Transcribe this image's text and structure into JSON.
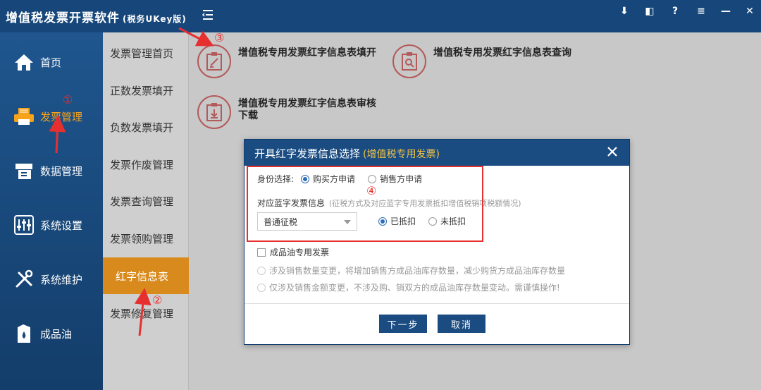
{
  "app": {
    "title": "增值税发票开票软件",
    "subtitle": "(税务UKey版)"
  },
  "window_controls": [
    "⬇",
    "◧",
    "?",
    "≡",
    "—",
    "✕"
  ],
  "sidebar": {
    "items": [
      {
        "label": "首页",
        "icon": "home-icon"
      },
      {
        "label": "发票管理",
        "icon": "printer-icon",
        "active": true
      },
      {
        "label": "数据管理",
        "icon": "data-icon"
      },
      {
        "label": "系统设置",
        "icon": "sliders-icon"
      },
      {
        "label": "系统维护",
        "icon": "tools-icon"
      },
      {
        "label": "成品油",
        "icon": "oil-icon"
      }
    ]
  },
  "submenu": {
    "items": [
      {
        "label": "发票管理首页"
      },
      {
        "label": "正数发票填开"
      },
      {
        "label": "负数发票填开"
      },
      {
        "label": "发票作废管理"
      },
      {
        "label": "发票查询管理"
      },
      {
        "label": "发票领购管理"
      },
      {
        "label": "红字信息表",
        "active": true
      },
      {
        "label": "发票修复管理"
      }
    ]
  },
  "tiles": [
    {
      "label": "增值税专用发票红字信息表填开",
      "icon": "form-edit-icon"
    },
    {
      "label": "增值税专用发票红字信息表查询",
      "icon": "form-search-icon"
    },
    {
      "label": "增值税专用发票红字信息表审核下载",
      "icon": "form-download-icon"
    }
  ],
  "dialog": {
    "title": "开具红字发票信息选择",
    "title_sub": "(增值税专用发票)",
    "identity_label": "身份选择:",
    "identity_options": [
      "购买方申请",
      "销售方申请"
    ],
    "blue_info_label": "对应蓝字发票信息",
    "blue_info_hint": "(征税方式及对应蓝字专用发票抵扣增值税销项税额情况)",
    "tax_select_value": "普通征税",
    "deduct_options": [
      "已抵扣",
      "未抵扣"
    ],
    "oil_checkbox_label": "成品油专用发票",
    "oil_option_1": "涉及销售数量变更，将增加销售方成品油库存数量，减少购货方成品油库存数量",
    "oil_option_2": "仅涉及销售金额变更，不涉及购、销双方的成品油库存数量变动。需谨慎操作!",
    "next_button": "下一步",
    "cancel_button": "取消"
  },
  "annotations": [
    "①",
    "②",
    "③",
    "④"
  ],
  "colors": {
    "titlebar": "#17477a",
    "accent_orange": "#d98a1c",
    "annotation_red": "#e63030",
    "dialog_header": "#1a4c82"
  }
}
